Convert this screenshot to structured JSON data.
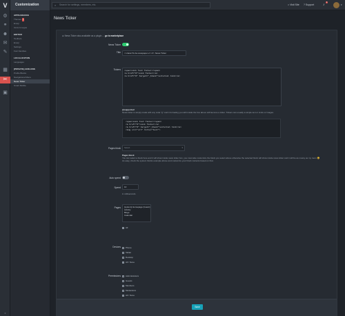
{
  "rail": {
    "logo": "V",
    "items": [
      "settings",
      "link",
      "users",
      "chat",
      "paint",
      "chart",
      "wrench",
      "store"
    ]
  },
  "sidebar": {
    "title": "Customization",
    "groups": [
      {
        "title": "APPEARANCE",
        "items": [
          {
            "label": "Themes",
            "badge": "1"
          },
          {
            "label": "Emoji"
          },
          {
            "label": "Icons & Logos"
          }
        ]
      },
      {
        "title": "EDITOR",
        "items": [
          {
            "label": "Toolbars"
          },
          {
            "label": "Emoji"
          },
          {
            "label": "Settings"
          },
          {
            "label": "Font Families"
          }
        ]
      },
      {
        "title": "LOCALIZATION",
        "items": [
          {
            "label": "Languages"
          }
        ]
      },
      {
        "title": "[PRIVATE] ADD-ONS",
        "items": [
          {
            "label": "Profile Blocks"
          },
          {
            "label": "Navigational Menu"
          },
          {
            "label": "News Ticker",
            "active": true
          },
          {
            "label": "Smart Mobile"
          }
        ]
      }
    ]
  },
  "topbar": {
    "search_placeholder": "Search for settings, members, etc.",
    "visit_site": "Visit Site",
    "support": "Support",
    "notif_count": "1"
  },
  "page": {
    "title": "News Ticker",
    "notice_pre": "News Ticker also available as a plugin ...",
    "notice_link": "go to marketplace",
    "fields": {
      "ticker_label": "News Ticker",
      "title_label": "Title",
      "title_value": "<i class='fa fa-newspaper-o'></i> News Ticker",
      "tickers_label": "Tickers",
      "pages_label": "Pages block",
      "pages_placeholder": "Select",
      "autospeed_label": "Auto speed",
      "speed_label": "Speed",
      "speed_value": "10",
      "speed_unit": "in milliseconds",
      "pages2_label": "Pages",
      "pages_list": [
        "[system] Homepage (Guest)",
        "Activity",
        "Blogs",
        "Calendar"
      ],
      "all_label": "All",
      "devices_label": "Devices",
      "devices": [
        "Phone",
        "Tablet",
        "Desktop"
      ],
      "devices_all": "All / None",
      "perm_label": "Permissions",
      "perms": [
        "Administrators",
        "Guests",
        "Members",
        "Moderators"
      ],
      "perms_all": "All / None",
      "save": "Save"
    },
    "tickers_code": [
      "<span>Link Text Ticker</span>",
      "<a href=\"#\">Link Ticker</a>",
      "<a href=\"#\" target=\"_blank\">external link</a>"
    ],
    "help1_title": "@supported",
    "help1_body": "News ticker is simply made with any code \"{}\" and it formating you with inside the box above will become a ticker. Tickers can usually a simple text or Links or Images.",
    "help_code": [
      "<span>Link Text Ticker</span>",
      "<a href=\"#\">Link Ticker</a>",
      "<a href=\"#\" target=\"_blank\">external link</a>",
      "<img src=\"url\" title=\"text\">"
    ],
    "help2_title": "Pages block",
    "help2_body": "You can select a block here and it will show inside news ticker box, you must also customize the block you select above otherwise the selected block will show inside news ticker and it will be as messy as my room 😀",
    "help2_body2": "As easy, check the system blocks example above and customize your block contents based on that."
  }
}
